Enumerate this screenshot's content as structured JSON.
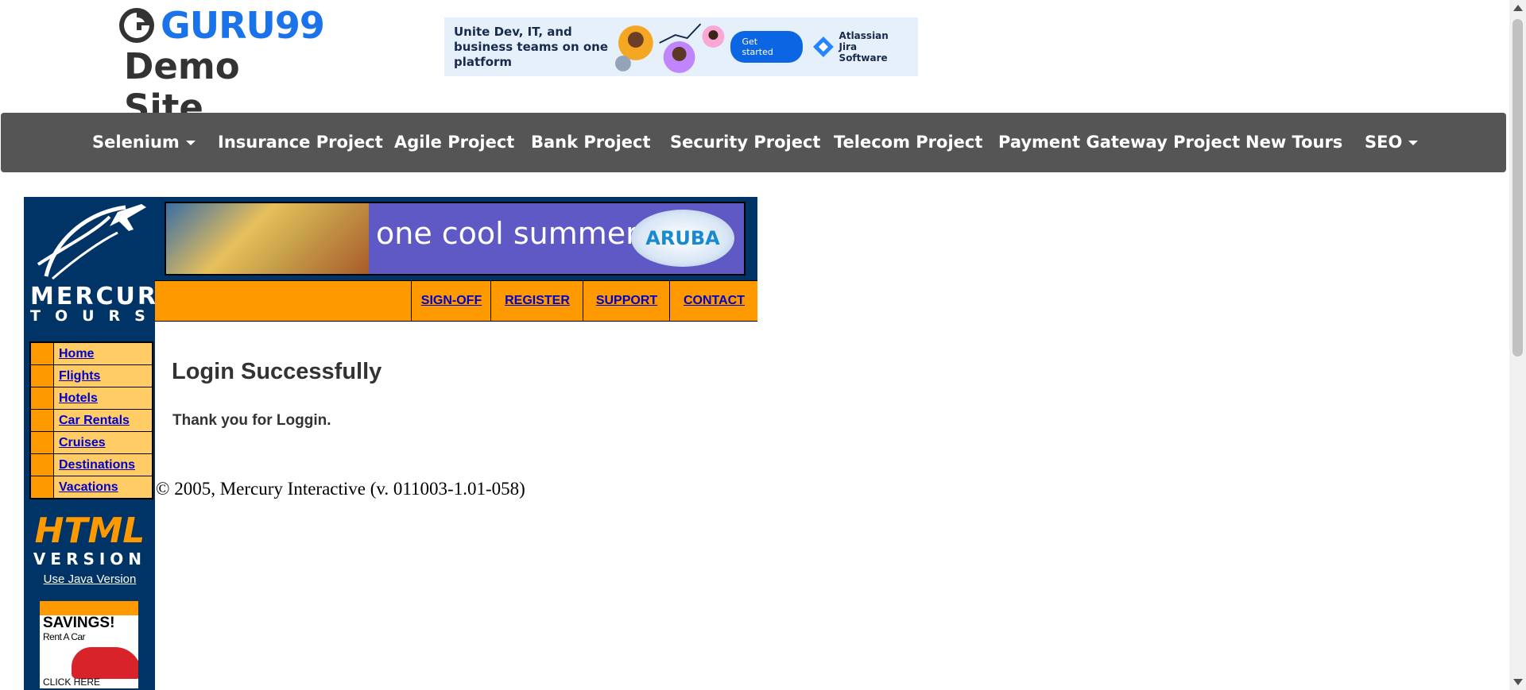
{
  "header": {
    "brand": "GURU99",
    "subtitle": "Demo Site",
    "ad": {
      "text": "Unite Dev, IT, and business teams on one platform",
      "button": "Get started",
      "brand_line1": "Atlassian",
      "brand_line2": "Jira Software"
    }
  },
  "nav": {
    "items": [
      {
        "label": "Selenium",
        "dropdown": true
      },
      {
        "label": "Insurance Project",
        "dropdown": false
      },
      {
        "label": "Agile Project",
        "dropdown": false
      },
      {
        "label": "Bank Project",
        "dropdown": false
      },
      {
        "label": "Security Project",
        "dropdown": false
      },
      {
        "label": "Telecom Project",
        "dropdown": false
      },
      {
        "label": "Payment Gateway Project",
        "dropdown": false
      },
      {
        "label": "New Tours",
        "dropdown": false
      },
      {
        "label": "SEO",
        "dropdown": true
      }
    ]
  },
  "mercury": {
    "logo_line1": "MERCURY",
    "logo_line2": "TOURS",
    "banner_text": "one cool summer",
    "banner_logo": "ARUBA",
    "top_links": [
      "SIGN-OFF",
      "REGISTER",
      "SUPPORT",
      "CONTACT"
    ],
    "side_menu": [
      "Home",
      "Flights",
      "Hotels",
      "Car Rentals",
      "Cruises",
      "Destinations",
      "Vacations"
    ],
    "html_version_word1": "HTML",
    "html_version_word2": "VERSION",
    "java_link": "Use Java Version",
    "savings_title": "SAVINGS!",
    "savings_sub": "Rent A Car",
    "savings_click": "CLICK HERE"
  },
  "content": {
    "title": "Login Successfully",
    "message": "Thank you for Loggin.",
    "copyright": "© 2005, Mercury Interactive (v. 011003-1.01-058)"
  },
  "colors": {
    "nav_bg": "#555555",
    "mercury_blue": "#003366",
    "mercury_orange": "#ff9900",
    "brand_blue": "#1a73e8"
  }
}
